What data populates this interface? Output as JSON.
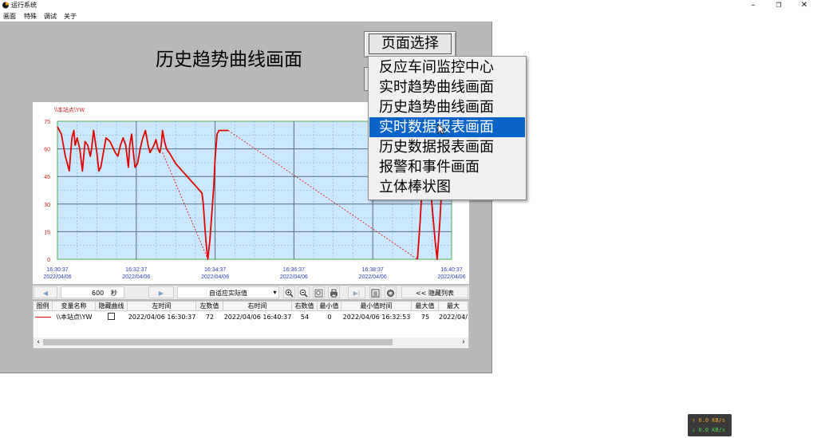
{
  "window": {
    "title": "运行系统",
    "controls": {
      "minimize": "–",
      "maximize": "❐",
      "close": "✕"
    }
  },
  "menu": [
    "画面",
    "特殊",
    "调试",
    "关于"
  ],
  "page_title": "历史趋势曲线画面",
  "page_select": {
    "label": "页面选择",
    "options": [
      "反应车间监控中心",
      "实时趋势曲线画面",
      "历史趋势曲线画面",
      "实时数据报表画面",
      "历史数据报表画面",
      "报警和事件画面",
      "立体棒状图"
    ],
    "highlighted": "实时数据报表画面"
  },
  "chart_data": {
    "type": "line",
    "title": "",
    "ylabel": "\\\\本站点\\YW",
    "ylim": [
      0,
      75
    ],
    "yticks": [
      "75",
      "60",
      "45",
      "30",
      "15",
      "0"
    ],
    "xticks": [
      {
        "time": "16:30:37",
        "date": "2022/04/06"
      },
      {
        "time": "16:32:37",
        "date": "2022/04/06"
      },
      {
        "time": "16:34:37",
        "date": "2022/04/06"
      },
      {
        "time": "16:36:37",
        "date": "2022/04/06"
      },
      {
        "time": "16:38:37",
        "date": "2022/04/06"
      },
      {
        "time": "16:40:37",
        "date": "2022/04/06"
      }
    ],
    "xlim_seconds": [
      0,
      600
    ],
    "series": [
      {
        "name": "\\\\本站点\\YW",
        "color": "#e00000",
        "segments": [
          [
            [
              0,
              72
            ],
            [
              6,
              68
            ],
            [
              12,
              56
            ],
            [
              18,
              48
            ],
            [
              22,
              66
            ],
            [
              25,
              70
            ],
            [
              27,
              62
            ],
            [
              30,
              66
            ],
            [
              34,
              60
            ],
            [
              38,
              48
            ],
            [
              42,
              64
            ],
            [
              46,
              62
            ],
            [
              50,
              56
            ],
            [
              52,
              60
            ],
            [
              55,
              70
            ],
            [
              60,
              58
            ],
            [
              63,
              48
            ],
            [
              66,
              50
            ],
            [
              70,
              58
            ],
            [
              74,
              66
            ],
            [
              80,
              64
            ],
            [
              88,
              58
            ],
            [
              92,
              56
            ],
            [
              96,
              62
            ],
            [
              100,
              66
            ],
            [
              104,
              62
            ],
            [
              108,
              50
            ],
            [
              110,
              62
            ],
            [
              113,
              68
            ],
            [
              115,
              60
            ],
            [
              118,
              50
            ],
            [
              122,
              52
            ],
            [
              126,
              60
            ],
            [
              130,
              66
            ],
            [
              134,
              70
            ],
            [
              138,
              62
            ],
            [
              141,
              58
            ],
            [
              144,
              60
            ],
            [
              147,
              62
            ],
            [
              150,
              65
            ],
            [
              153,
              60
            ],
            [
              156,
              58
            ],
            [
              158,
              62
            ],
            [
              160,
              70
            ],
            [
              163,
              64
            ],
            [
              166,
              60
            ],
            [
              170,
              58
            ],
            [
              175,
              55
            ],
            [
              180,
              52
            ],
            [
              185,
              50
            ],
            [
              190,
              48
            ],
            [
              195,
              46
            ],
            [
              200,
              44
            ],
            [
              205,
              42
            ],
            [
              210,
              40
            ],
            [
              215,
              38
            ],
            [
              220,
              36
            ],
            [
              222,
              30
            ],
            [
              224,
              20
            ],
            [
              226,
              10
            ],
            [
              228,
              3
            ],
            [
              229,
              0
            ],
            [
              232,
              10
            ],
            [
              235,
              25
            ],
            [
              238,
              40
            ],
            [
              240,
              55
            ],
            [
              243,
              68
            ],
            [
              246,
              70
            ],
            [
              250,
              70
            ],
            [
              256,
              70
            ],
            [
              260,
              70
            ]
          ],
          [
            [
              548,
              0
            ],
            [
              552,
              20
            ],
            [
              556,
              45
            ],
            [
              560,
              70
            ],
            [
              563,
              65
            ],
            [
              566,
              50
            ],
            [
              570,
              30
            ],
            [
              575,
              10
            ],
            [
              578,
              0
            ],
            [
              582,
              20
            ],
            [
              586,
              45
            ],
            [
              590,
              68
            ],
            [
              594,
              70
            ],
            [
              598,
              66
            ],
            [
              600,
              54
            ]
          ]
        ],
        "dashed_links": [
          [
            [
              160,
              58
            ],
            [
              229,
              0
            ]
          ],
          [
            [
              260,
              70
            ],
            [
              548,
              0
            ]
          ]
        ]
      }
    ],
    "grid": true,
    "background": "#cce8ff"
  },
  "toolbar": {
    "prev_icon": "◀",
    "span_value": "600",
    "span_unit": "秒",
    "next_icon": "▶",
    "mode_select": "自适应实际值",
    "select_arrow": "▾",
    "hide_list": "<<  隐藏列表",
    "icons": [
      "zoom-in-icon",
      "zoom-out-icon",
      "zoom-reset-icon",
      "print-icon",
      "stop-icon",
      "settings-icon",
      "camera-icon"
    ]
  },
  "table": {
    "headers": [
      "图例",
      "变量名称",
      "隐藏曲线",
      "左时间",
      "左数值",
      "右时间",
      "右数值",
      "最小值",
      "最小值时间",
      "最大值",
      "最大"
    ],
    "rows": [
      {
        "legend_color": "#e00000",
        "name": "\\\\本站点\\YW",
        "hidden": false,
        "left_time": "2022/04/06 16:30:37",
        "left_value": "72",
        "right_time": "2022/04/06 16:40:37",
        "right_value": "54",
        "min": "0",
        "min_time": "2022/04/06 16:32:53",
        "max": "75",
        "max_time": "2022/04/"
      }
    ],
    "scroll_left": "‹",
    "scroll_right": "›"
  },
  "netspeed": {
    "up": "↑ 0.0 KB/s",
    "down": "↓ 0.0 KB/s"
  }
}
